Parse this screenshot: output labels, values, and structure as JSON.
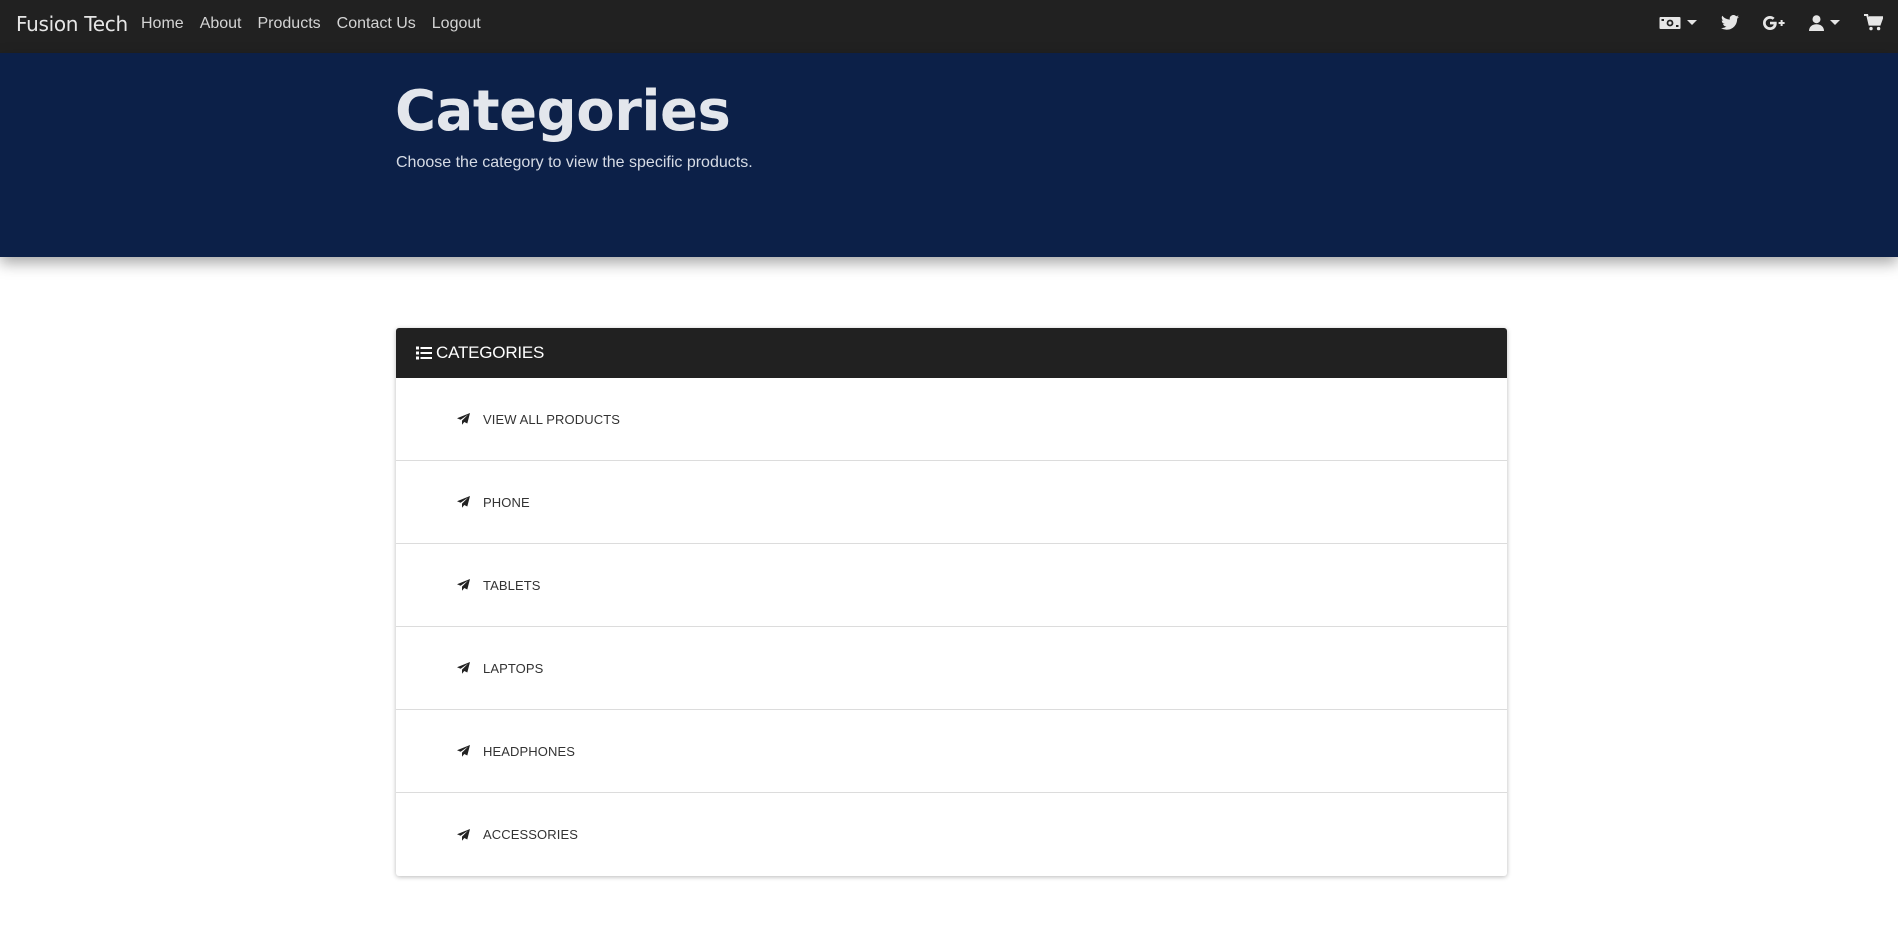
{
  "navbar": {
    "brand": "Fusion Tech",
    "links": [
      "Home",
      "About",
      "Products",
      "Contact Us",
      "Logout"
    ],
    "icons": [
      "money-icon",
      "twitter-icon",
      "google-plus-icon",
      "user-icon",
      "cart-icon"
    ]
  },
  "hero": {
    "title": "Categories",
    "subtitle": "Choose the category to view the specific products."
  },
  "card": {
    "header_title": "CATEGORIES",
    "header_icon": "list-icon",
    "item_icon": "paper-plane-icon",
    "items": [
      {
        "label": "VIEW ALL PRODUCTS"
      },
      {
        "label": "PHONE"
      },
      {
        "label": "TABLETS"
      },
      {
        "label": "LAPTOPS"
      },
      {
        "label": "HEADPHONES"
      },
      {
        "label": "ACCESSORIES"
      }
    ]
  },
  "colors": {
    "navbar_bg": "#212121",
    "hero_bg": "#0c2048",
    "card_header_bg": "#212121"
  }
}
